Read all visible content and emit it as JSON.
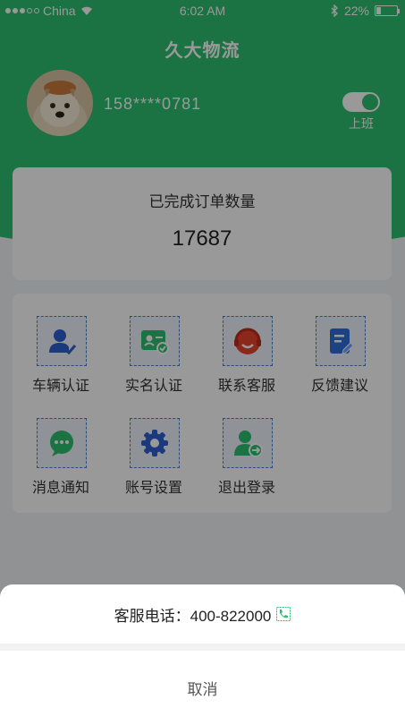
{
  "status_bar": {
    "carrier": "China",
    "time": "6:02 AM",
    "battery": "22%",
    "battery_level": 0.22
  },
  "header": {
    "title": "久大物流",
    "phone": "158****0781",
    "duty_label": "上班",
    "duty_on": true
  },
  "order_card": {
    "label": "已完成订单数量",
    "count": "17687"
  },
  "menu": [
    {
      "label": "车辆认证",
      "icon": "vehicle-verify-icon"
    },
    {
      "label": "实名认证",
      "icon": "id-verify-icon"
    },
    {
      "label": "联系客服",
      "icon": "customer-service-icon"
    },
    {
      "label": "反馈建议",
      "icon": "feedback-icon"
    },
    {
      "label": "消息通知",
      "icon": "message-icon"
    },
    {
      "label": "账号设置",
      "icon": "settings-gear-icon"
    },
    {
      "label": "退出登录",
      "icon": "logout-icon"
    }
  ],
  "action_sheet": {
    "phone_text": "客服电话：400-822000",
    "cancel_label": "取消"
  },
  "colors": {
    "brand_green": "#2ec070",
    "accent_blue": "#2f5fd1",
    "accent_red": "#e8412d"
  }
}
